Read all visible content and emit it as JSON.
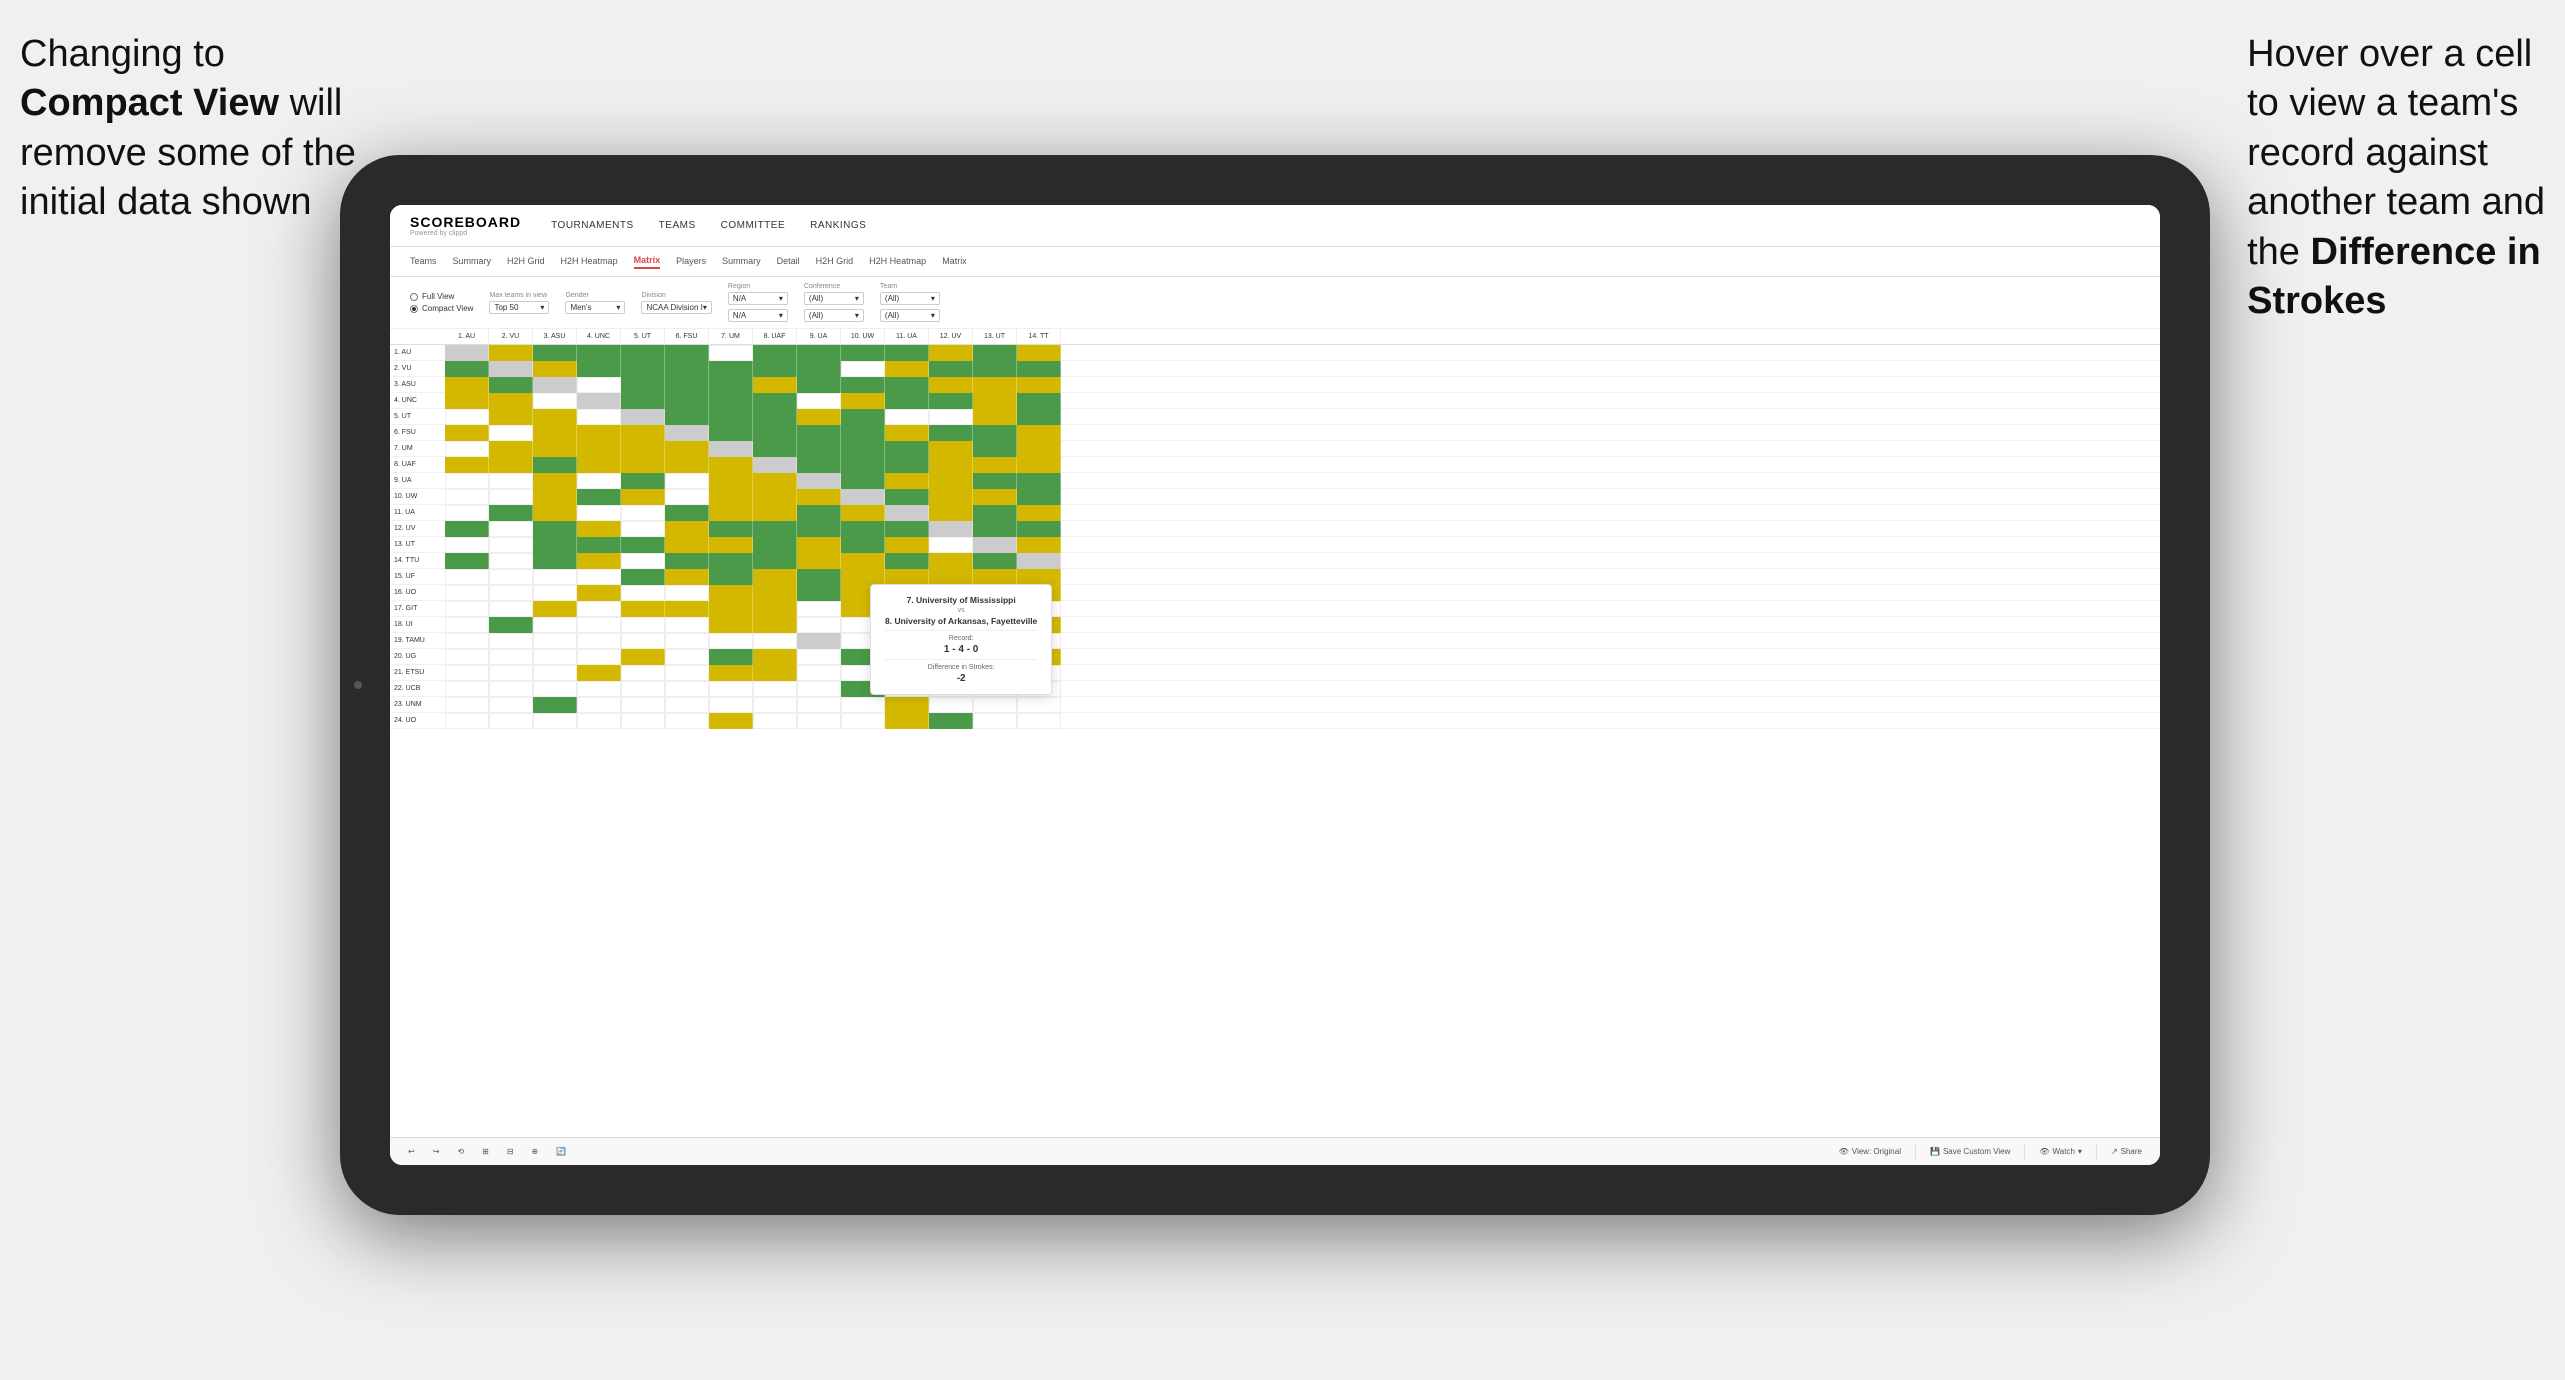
{
  "annotations": {
    "left_text_line1": "Changing to",
    "left_text_line2": "Compact View",
    "left_text_line3": " will",
    "left_text_line4": "remove some of the",
    "left_text_line5": "initial data shown",
    "right_text_line1": "Hover over a cell",
    "right_text_line2": "to view a team's",
    "right_text_line3": "record against",
    "right_text_line4": "another team and",
    "right_text_line5": "the ",
    "right_text_bold": "Difference in",
    "right_text_line6": "Strokes"
  },
  "nav": {
    "logo": "SCOREBOARD",
    "logo_sub": "Powered by clippd",
    "links": [
      "TOURNAMENTS",
      "TEAMS",
      "COMMITTEE",
      "RANKINGS"
    ]
  },
  "sub_nav": {
    "tabs": [
      "Teams",
      "Summary",
      "H2H Grid",
      "H2H Heatmap",
      "Matrix",
      "Players",
      "Summary",
      "Detail",
      "H2H Grid",
      "H2H Heatmap",
      "Matrix"
    ],
    "active": "Matrix"
  },
  "filters": {
    "view_options": [
      "Full View",
      "Compact View"
    ],
    "selected_view": "Compact View",
    "max_teams_label": "Max teams in view",
    "max_teams_value": "Top 50",
    "gender_label": "Gender",
    "gender_value": "Men's",
    "division_label": "Division",
    "division_value": "NCAA Division I",
    "region_label": "Region",
    "region_value": "N/A",
    "conference_label": "Conference",
    "conference_value": "(All)",
    "team_label": "Team",
    "team_value": "(All)"
  },
  "col_headers": [
    "1. AU",
    "2. VU",
    "3. ASU",
    "4. UNC",
    "5. UT",
    "6. FSU",
    "7. UM",
    "8. UAF",
    "9. UA",
    "10. UW",
    "11. UA",
    "12. UV",
    "13. UT",
    "14. TT"
  ],
  "rows": [
    {
      "label": "1. AU"
    },
    {
      "label": "2. VU"
    },
    {
      "label": "3. ASU"
    },
    {
      "label": "4. UNC"
    },
    {
      "label": "5. UT"
    },
    {
      "label": "6. FSU"
    },
    {
      "label": "7. UM"
    },
    {
      "label": "8. UAF"
    },
    {
      "label": "9. UA"
    },
    {
      "label": "10. UW"
    },
    {
      "label": "11. UA"
    },
    {
      "label": "12. UV"
    },
    {
      "label": "13. UT"
    },
    {
      "label": "14. TTU"
    },
    {
      "label": "15. UF"
    },
    {
      "label": "16. UO"
    },
    {
      "label": "17. GIT"
    },
    {
      "label": "18. UI"
    },
    {
      "label": "19. TAMU"
    },
    {
      "label": "20. UG"
    },
    {
      "label": "21. ETSU"
    },
    {
      "label": "22. UCB"
    },
    {
      "label": "23. UNM"
    },
    {
      "label": "24. UO"
    }
  ],
  "tooltip": {
    "team1": "7. University of Mississippi",
    "vs": "vs",
    "team2": "8. University of Arkansas, Fayetteville",
    "record_label": "Record:",
    "record": "1 - 4 - 0",
    "diff_label": "Difference in Strokes:",
    "diff": "-2"
  },
  "toolbar": {
    "buttons": [
      "↩",
      "↪",
      "⟲",
      "⊞",
      "⊟",
      "⊕",
      "🔄"
    ],
    "view_original": "View: Original",
    "save_custom": "Save Custom View",
    "watch": "Watch",
    "share": "Share"
  }
}
